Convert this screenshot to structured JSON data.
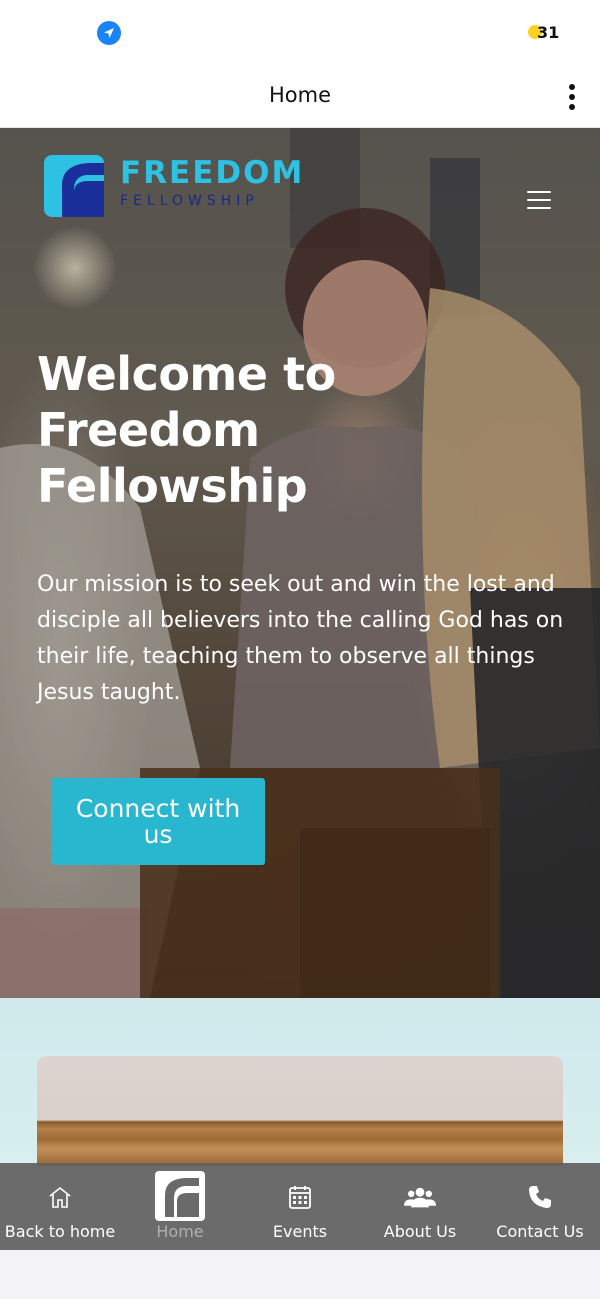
{
  "status_bar": {
    "location_icon": "location-arrow-icon",
    "notification_count": "31",
    "notification_color": "#ffd21f"
  },
  "header": {
    "title": "Home",
    "menu_icon": "more-vertical-icon"
  },
  "hero": {
    "logo": {
      "word": "FREEDOM",
      "sub": "FELLOWSHIP"
    },
    "menu_icon": "hamburger-icon",
    "title": "Welcome to Freedom Fellowship",
    "text": "Our mission is to seek out and win the lost and disciple all believers into the calling God has on their life, teaching them to observe all things Jesus taught.",
    "cta_label": "Connect with us",
    "accent_color": "#29b6cf"
  },
  "tab_bar": {
    "items": [
      {
        "label": "Back to home",
        "icon": "home-icon",
        "active": false
      },
      {
        "label": "Home",
        "icon": "app-logo-icon",
        "active": true
      },
      {
        "label": "Events",
        "icon": "calendar-icon",
        "active": false
      },
      {
        "label": "About Us",
        "icon": "users-icon",
        "active": false
      },
      {
        "label": "Contact Us",
        "icon": "phone-icon",
        "active": false
      }
    ]
  }
}
